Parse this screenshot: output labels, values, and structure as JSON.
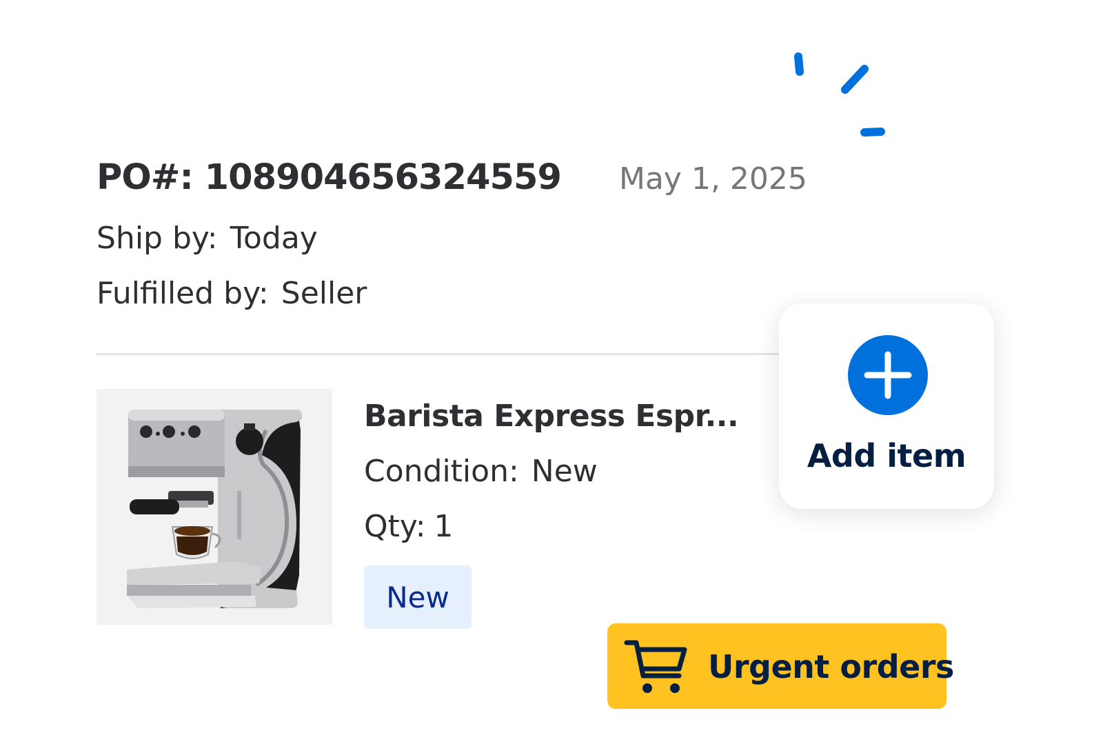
{
  "order": {
    "po_label": "PO#:",
    "po_number": "108904656324559",
    "date": "May 1, 2025",
    "ship_by_label": "Ship by:",
    "ship_by_value": "Today",
    "fulfilled_by_label": "Fulfilled by:",
    "fulfilled_by_value": "Seller"
  },
  "item": {
    "title": "Barista Express Espr...",
    "condition_label": "Condition:",
    "condition_value": "New",
    "qty_label": "Qty:",
    "qty_value": "1",
    "badge": "New",
    "image_icon": "espresso-machine"
  },
  "add_item": {
    "label": "Add item",
    "icon": "plus-circle-icon"
  },
  "urgent": {
    "label": "Urgent orders",
    "icon": "cart-icon"
  },
  "colors": {
    "accent_blue": "#0071dc",
    "navy": "#041f41",
    "yellow": "#ffc220",
    "badge_bg": "#e6f0fc",
    "text_dark": "#2e2f32",
    "text_muted": "#74767c"
  }
}
